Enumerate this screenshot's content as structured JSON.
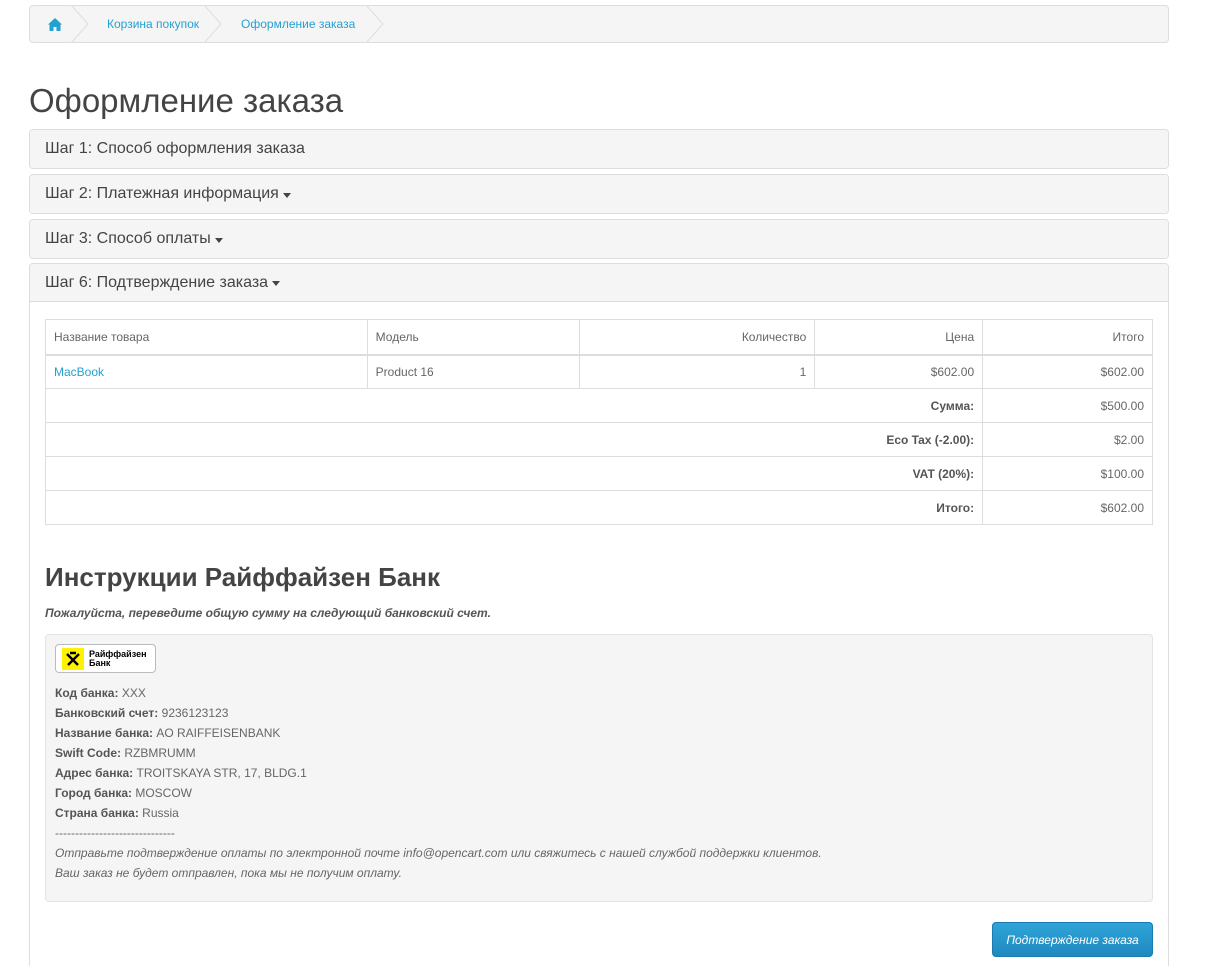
{
  "breadcrumb": {
    "home": "home",
    "cart": "Корзина покупок",
    "checkout": "Оформление заказа"
  },
  "page_title": "Оформление заказа",
  "steps": [
    "Шаг 1: Способ оформления заказа",
    "Шаг 2: Платежная информация",
    "Шаг 3: Способ оплаты",
    "Шаг 6: Подтверждение заказа"
  ],
  "table": {
    "headers": [
      "Название товара",
      "Модель",
      "Количество",
      "Цена",
      "Итого"
    ],
    "rows": [
      {
        "name": "MacBook",
        "model": "Product 16",
        "qty": "1",
        "price": "$602.00",
        "total": "$602.00"
      }
    ],
    "totals": [
      {
        "label": "Сумма:",
        "value": "$500.00"
      },
      {
        "label": "Eco Tax (-2.00):",
        "value": "$2.00"
      },
      {
        "label": "VAT (20%):",
        "value": "$100.00"
      },
      {
        "label": "Итого:",
        "value": "$602.00"
      }
    ]
  },
  "instructions": {
    "title": "Инструкции Райффайзен Банк",
    "subtitle": "Пожалуйста, переведите общую сумму на следующий банковский счет.",
    "logo_text_1": "Райффайзен",
    "logo_text_2": "Банк",
    "fields": [
      {
        "label": "Код банка:",
        "value": "XXX"
      },
      {
        "label": "Банковский счет:",
        "value": "9236123123"
      },
      {
        "label": "Название банка:",
        "value": "AO RAIFFEISENBANK"
      },
      {
        "label": "Swift Code:",
        "value": "RZBMRUMM"
      },
      {
        "label": "Адрес банка:",
        "value": "TROITSKAYA STR, 17, BLDG.1"
      },
      {
        "label": "Город банка:",
        "value": "MOSCOW"
      },
      {
        "label": "Страна банка:",
        "value": "Russia"
      }
    ],
    "separator": "------------------------------",
    "note_1": "Отправьте подтверждение оплаты по электронной почте info@opencart.com или свяжитесь с нашей службой поддержки клиентов.",
    "note_2": "Ваш заказ не будет отправлен, пока мы не получим оплату."
  },
  "confirm_button": "Подтверждение заказа",
  "colors": {
    "link": "#23a1d1",
    "button": "#229ac8",
    "logo_yellow": "#fff200"
  }
}
